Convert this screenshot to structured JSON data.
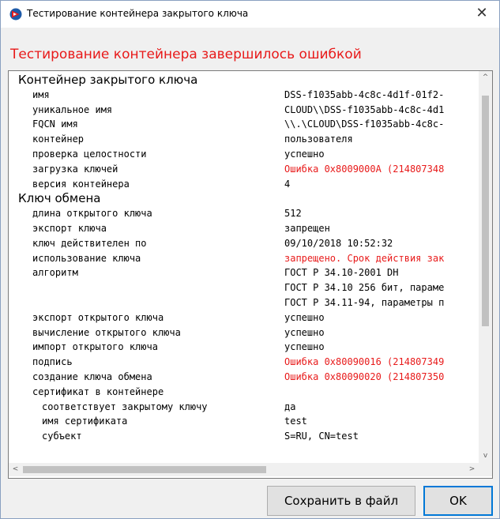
{
  "window": {
    "title": "Тестирование контейнера закрытого ключа",
    "close_glyph": "✕"
  },
  "heading": "Тестирование контейнера завершилось ошибкой",
  "colors": {
    "error": "#e81a1a",
    "accent": "#0078d7"
  },
  "rows": [
    {
      "type": "section",
      "label": "Контейнер закрытого ключа"
    },
    {
      "type": "item",
      "indent": 1,
      "label": "имя",
      "value": "DSS-f1035abb-4c8c-4d1f-01f2-"
    },
    {
      "type": "item",
      "indent": 1,
      "label": "уникальное имя",
      "value": "CLOUD\\\\DSS-f1035abb-4c8c-4d1"
    },
    {
      "type": "item",
      "indent": 1,
      "label": "FQCN имя",
      "value": "\\\\.\\CLOUD\\DSS-f1035abb-4c8c-"
    },
    {
      "type": "item",
      "indent": 1,
      "label": "контейнер",
      "value": "пользователя"
    },
    {
      "type": "item",
      "indent": 1,
      "label": "проверка целостности",
      "value": "успешно"
    },
    {
      "type": "item",
      "indent": 1,
      "label": "загрузка ключей",
      "value": "Ошибка 0x8009000A (214807348",
      "error": true
    },
    {
      "type": "item",
      "indent": 1,
      "label": "версия контейнера",
      "value": "4"
    },
    {
      "type": "section",
      "label": "Ключ обмена"
    },
    {
      "type": "item",
      "indent": 1,
      "label": "длина открытого ключа",
      "value": "512"
    },
    {
      "type": "item",
      "indent": 1,
      "label": "экспорт ключа",
      "value": "запрещен"
    },
    {
      "type": "item",
      "indent": 1,
      "label": "ключ действителен по",
      "value": "09/10/2018  10:52:32"
    },
    {
      "type": "item",
      "indent": 1,
      "label": "использование ключа",
      "value": "запрещено. Срок действия зак",
      "error": true
    },
    {
      "type": "item",
      "indent": 1,
      "label": "алгоритм",
      "value": "ГОСТ Р 34.10-2001 DH"
    },
    {
      "type": "item",
      "indent": 1,
      "label": "",
      "value": "ГОСТ Р 34.10 256 бит, параме"
    },
    {
      "type": "item",
      "indent": 1,
      "label": "",
      "value": "ГОСТ Р 34.11-94, параметры п"
    },
    {
      "type": "item",
      "indent": 1,
      "label": "экспорт открытого ключа",
      "value": "успешно"
    },
    {
      "type": "item",
      "indent": 1,
      "label": "вычисление открытого ключа",
      "value": "успешно"
    },
    {
      "type": "item",
      "indent": 1,
      "label": "импорт открытого ключа",
      "value": "успешно"
    },
    {
      "type": "item",
      "indent": 1,
      "label": "подпись",
      "value": "Ошибка 0x80090016 (214807349",
      "error": true
    },
    {
      "type": "item",
      "indent": 1,
      "label": "создание ключа обмена",
      "value": "Ошибка 0x80090020 (214807350",
      "error": true
    },
    {
      "type": "item",
      "indent": 1,
      "label": "сертификат в контейнере",
      "value": ""
    },
    {
      "type": "item",
      "indent": 2,
      "label": "соответствует закрытому ключу",
      "value": "да"
    },
    {
      "type": "item",
      "indent": 2,
      "label": "имя сертификата",
      "value": "test"
    },
    {
      "type": "item",
      "indent": 2,
      "label": "субъект",
      "value": "S=RU, CN=test"
    }
  ],
  "scrollbars": {
    "up_glyph": "^",
    "down_glyph": "v",
    "left_glyph": "<",
    "right_glyph": ">"
  },
  "buttons": {
    "save_label": "Сохранить в файл",
    "ok_label": "OK"
  }
}
